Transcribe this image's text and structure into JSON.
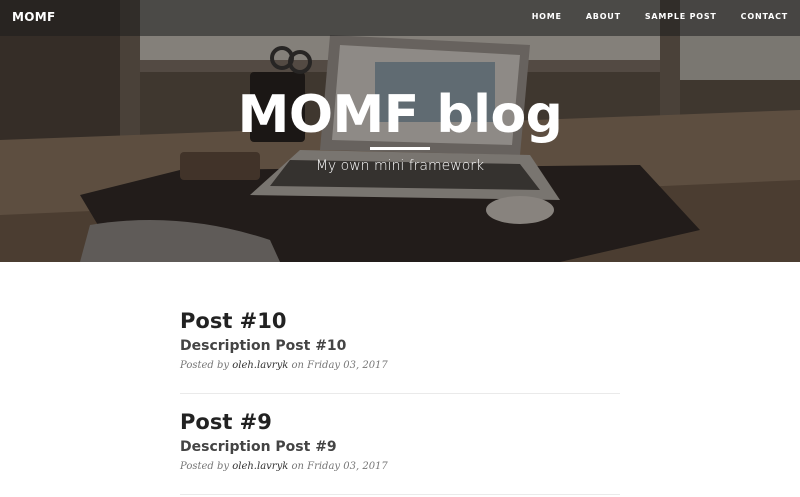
{
  "nav": {
    "brand": "MOMF",
    "links": [
      "HOME",
      "ABOUT",
      "SAMPLE POST",
      "CONTACT"
    ]
  },
  "hero": {
    "title": "MOMF blog",
    "subtitle": "My own mini framework"
  },
  "posts": [
    {
      "title": "Post #10",
      "description": "Description Post #10",
      "posted_by": "Posted by",
      "author": "oleh.lavryk",
      "on": "on",
      "date": "Friday 03, 2017"
    },
    {
      "title": "Post #9",
      "description": "Description Post #9",
      "posted_by": "Posted by",
      "author": "oleh.lavryk",
      "on": "on",
      "date": "Friday 03, 2017"
    }
  ]
}
